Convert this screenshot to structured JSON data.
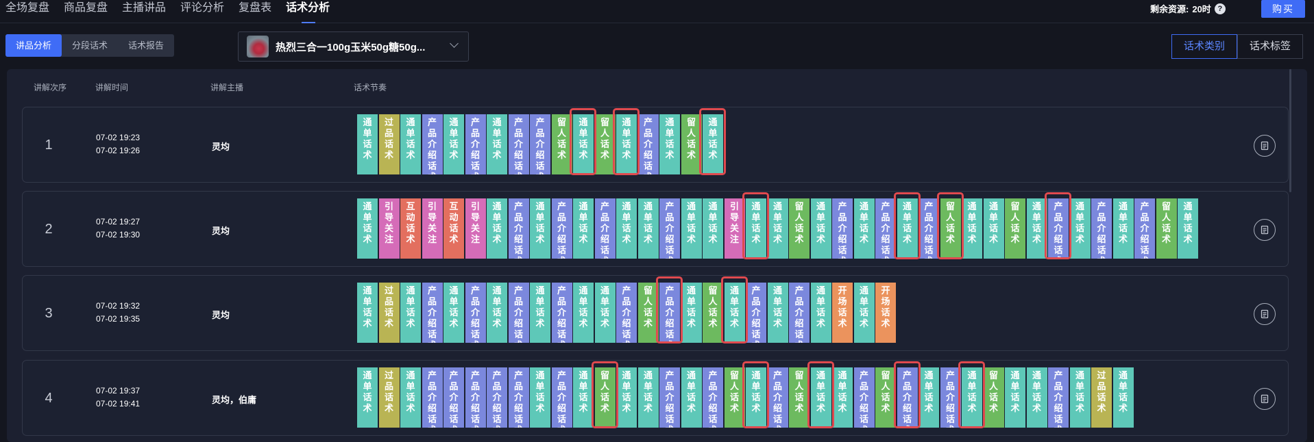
{
  "topnav": [
    "全场复盘",
    "商品复盘",
    "主播讲品",
    "评论分析",
    "复盘表",
    "话术分析"
  ],
  "topnav_active": 5,
  "resource": {
    "label": "剩余资源:",
    "value": "20时",
    "help_icon": "question-circle-icon"
  },
  "buy_label": "购买",
  "subtabs": [
    "讲品分析",
    "分段话术",
    "话术报告"
  ],
  "subtabs_active": 0,
  "product": {
    "name": "热烈三合一100g玉米50g糖50g...",
    "icon": "chevron-down-icon"
  },
  "view_toggle": [
    "话术类别",
    "话术标签"
  ],
  "view_active": 0,
  "columns": [
    "讲解次序",
    "讲解时间",
    "讲解主播",
    "话术节奏"
  ],
  "types": {
    "t": {
      "label": "通单话术",
      "color": "#5ec8b8"
    },
    "p": {
      "label": "产品介绍话术",
      "color": "#7b88dd"
    },
    "l": {
      "label": "留人话术",
      "color": "#6dba5f"
    },
    "g": {
      "label": "过品话术",
      "color": "#b9b454"
    },
    "y": {
      "label": "引导关注",
      "color": "#d56cb8"
    },
    "h": {
      "label": "互动话术",
      "color": "#e36f5f"
    },
    "k": {
      "label": "开场话术",
      "color": "#eb935d"
    }
  },
  "rows": [
    {
      "order": "1",
      "start": "07-02 19:23",
      "end": "07-02 19:26",
      "host": "灵均",
      "blocks": "tgtptptppltltptlt",
      "highlighted": [
        10,
        12,
        16
      ]
    },
    {
      "order": "2",
      "start": "07-02 19:27",
      "end": "07-02 19:30",
      "host": "灵均",
      "blocks": "tyhyhytptptpttpttyttltptptplttltptptplt",
      "highlighted": [
        18,
        25,
        27,
        32
      ]
    },
    {
      "order": "3",
      "start": "07-02 19:32",
      "end": "07-02 19:35",
      "host": "灵均",
      "blocks": "tgtptptptpttplptltptptktk",
      "highlighted": [
        14,
        17
      ]
    },
    {
      "order": "4",
      "start": "07-02 19:37",
      "end": "07-02 19:41",
      "host": "灵均，伯庸",
      "blocks": "tgtppppptptlttptpltplttplptptlttptgt",
      "highlighted": [
        11,
        18,
        21,
        25,
        28
      ]
    }
  ]
}
